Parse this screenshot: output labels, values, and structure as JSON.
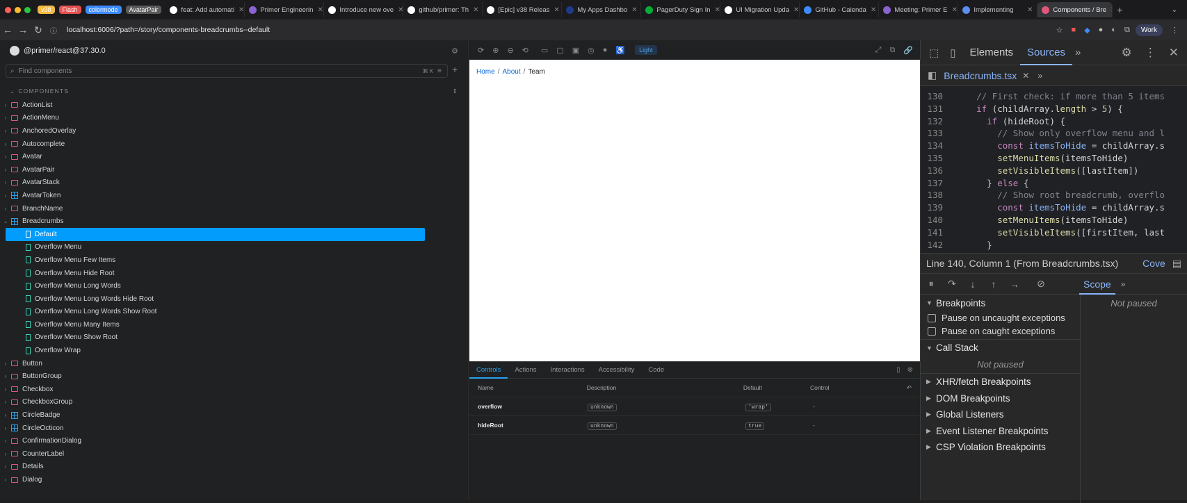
{
  "browser": {
    "pills": [
      {
        "label": "v38",
        "color": "#f5b942"
      },
      {
        "label": "Flash",
        "color": "#e55050"
      },
      {
        "label": "colormode",
        "color": "#3d8bfd"
      },
      {
        "label": "AvatarPair",
        "color": "#5a5a5a"
      }
    ],
    "tabs": [
      "feat: Add automati",
      "Primer Engineerin",
      "Introduce new ove",
      "github/primer: Th",
      "[Epic] v38 Releas",
      "My Apps Dashbo",
      "PagerDuty Sign In",
      "UI Migration Upda",
      "GitHub - Calenda",
      "Meeting: Primer E",
      "Implementing",
      "Components / Bre"
    ],
    "tab_colors": [
      "#ffffff",
      "#8a63d2",
      "#ffffff",
      "#ffffff",
      "#ffffff",
      "#1e3a8a",
      "#06ac38",
      "#ffffff",
      "#3d8bfd",
      "#8a63d2",
      "#5b8def",
      "#e0577a"
    ],
    "url": "localhost:6006/?path=/story/components-breadcrumbs--default",
    "profile": "Work"
  },
  "sidebar": {
    "title": "@primer/react@37.30.0",
    "search_placeholder": "Find components",
    "search_shortcut": "⌘ K",
    "section": "COMPONENTS",
    "items_top": [
      {
        "label": "ActionList",
        "kind": "folder"
      },
      {
        "label": "ActionMenu",
        "kind": "folder"
      },
      {
        "label": "AnchoredOverlay",
        "kind": "folder"
      },
      {
        "label": "Autocomplete",
        "kind": "folder"
      },
      {
        "label": "Avatar",
        "kind": "folder"
      },
      {
        "label": "AvatarPair",
        "kind": "folder"
      },
      {
        "label": "AvatarStack",
        "kind": "folder"
      },
      {
        "label": "AvatarToken",
        "kind": "comp"
      },
      {
        "label": "BranchName",
        "kind": "folder"
      },
      {
        "label": "Breadcrumbs",
        "kind": "comp"
      }
    ],
    "stories": [
      "Default",
      "Overflow Menu",
      "Overflow Menu Few Items",
      "Overflow Menu Hide Root",
      "Overflow Menu Long Words",
      "Overflow Menu Long Words Hide Root",
      "Overflow Menu Long Words Show Root",
      "Overflow Menu Many Items",
      "Overflow Menu Show Root",
      "Overflow Wrap"
    ],
    "items_bottom": [
      {
        "label": "Button",
        "kind": "folder"
      },
      {
        "label": "ButtonGroup",
        "kind": "folder"
      },
      {
        "label": "Checkbox",
        "kind": "folder"
      },
      {
        "label": "CheckboxGroup",
        "kind": "folder"
      },
      {
        "label": "CircleBadge",
        "kind": "comp"
      },
      {
        "label": "CircleOcticon",
        "kind": "comp"
      },
      {
        "label": "ConfirmationDialog",
        "kind": "folder"
      },
      {
        "label": "CounterLabel",
        "kind": "folder"
      },
      {
        "label": "Details",
        "kind": "folder"
      },
      {
        "label": "Dialog",
        "kind": "folder"
      }
    ]
  },
  "preview": {
    "theme": "Light",
    "crumbs": [
      "Home",
      "About",
      "Team"
    ],
    "sep": "/"
  },
  "addons": {
    "tabs": [
      "Controls",
      "Actions",
      "Interactions",
      "Accessibility",
      "Code"
    ],
    "headers": [
      "Name",
      "Description",
      "Default",
      "Control"
    ],
    "rows": [
      {
        "name": "overflow",
        "desc": "unknown",
        "default": "'wrap'",
        "control": "-"
      },
      {
        "name": "hideRoot",
        "desc": "unknown",
        "default": "true",
        "control": "-"
      }
    ]
  },
  "devtools": {
    "tabs": [
      "Elements",
      "Sources"
    ],
    "file": "Breadcrumbs.tsx",
    "code": [
      {
        "n": "130",
        "t": "    // First check: if more than 5 items"
      },
      {
        "n": "131",
        "t": "    if (childArray.length > 5) {"
      },
      {
        "n": "132",
        "t": "      if (hideRoot) {"
      },
      {
        "n": "133",
        "t": "        // Show only overflow menu and l"
      },
      {
        "n": "134",
        "t": "        const itemsToHide = childArray.s"
      },
      {
        "n": "135",
        "t": "        setMenuItems(itemsToHide)"
      },
      {
        "n": "136",
        "t": "        setVisibleItems([lastItem])"
      },
      {
        "n": "137",
        "t": "      } else {"
      },
      {
        "n": "138",
        "t": "        // Show root breadcrumb, overflo"
      },
      {
        "n": "139",
        "t": "        const itemsToHide = childArray.s"
      },
      {
        "n": "140",
        "t": "        setMenuItems(itemsToHide)"
      },
      {
        "n": "141",
        "t": "        setVisibleItems([firstItem, last"
      },
      {
        "n": "142",
        "t": "      }"
      }
    ],
    "status": "Line 140, Column 1 (From Breadcrumbs.tsx)",
    "coverage": "Cove",
    "scope": "Scope",
    "not_paused": "Not paused",
    "breakpoints": "Breakpoints",
    "pause_uncaught": "Pause on uncaught exceptions",
    "pause_caught": "Pause on caught exceptions",
    "call_stack": "Call Stack",
    "sections": [
      "XHR/fetch Breakpoints",
      "DOM Breakpoints",
      "Global Listeners",
      "Event Listener Breakpoints",
      "CSP Violation Breakpoints"
    ]
  }
}
